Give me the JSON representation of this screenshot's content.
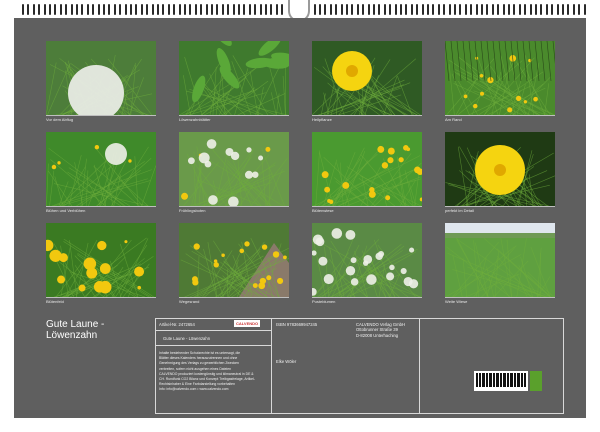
{
  "photos": [
    {
      "caption": "Vor dem Abflug",
      "scene": "dandelion-clock"
    },
    {
      "caption": "Löwenzahnblätter",
      "scene": "leaves"
    },
    {
      "caption": "Heilpflanze",
      "scene": "single-flower"
    },
    {
      "caption": "Am Rand",
      "scene": "fence-meadow"
    },
    {
      "caption": "Blühen und Verblühen",
      "scene": "flowers-and-clock"
    },
    {
      "caption": "Frühlingsboten",
      "scene": "clocks-field"
    },
    {
      "caption": "Blütenwiese",
      "scene": "meadow"
    },
    {
      "caption": "perfekt im Detail",
      "scene": "single-flower-dark"
    },
    {
      "caption": "Blütenfeld",
      "scene": "flower-field"
    },
    {
      "caption": "Wegesrand",
      "scene": "path"
    },
    {
      "caption": "Pusteblumen",
      "scene": "clocks-dense"
    },
    {
      "caption": "Weite Wiese",
      "scene": "wide-meadow"
    }
  ],
  "calendar": {
    "title_line1": "Gute Laune -",
    "title_line2": "Löwenzahn"
  },
  "info": {
    "article_no": "Artikel-Nr. 2472654",
    "logo_text": "CALVENDO",
    "isbn": "ISBN 9783669947245",
    "subtitle": "Gute Laune - Löwenzahn",
    "author": "Elke Wöler",
    "publisher_lines": [
      "CALVENDO Verlag GmbH",
      "Ottobrunner Straße 39",
      "D-82008 Unterhaching"
    ],
    "legal_lines": [
      "Inhalte bestehender Schutzrechte ist es untersagt, die",
      "Blätter dieses Kalenders herauszutrennen und ohne",
      "Genehmigung des Verlags zu gewerblichen Zwecken",
      "verbreiten, sofern nicht ausgehen eines Dateien",
      "CALVENDO produziert kostengünstig und klimaneutral in DE &",
      "CH. Rundfunk CO2 Bilanz und Konzept Treibgasfreiage, Artikel-",
      "Rechtsinhaber & Eine Farbdarstellung vorbehalten",
      "Info: info@calvendo.com • www.calvendo.com"
    ]
  },
  "colors": {
    "background": "#5f5f5f",
    "grass": "#3f8a2a",
    "flower": "#f2c80f"
  }
}
